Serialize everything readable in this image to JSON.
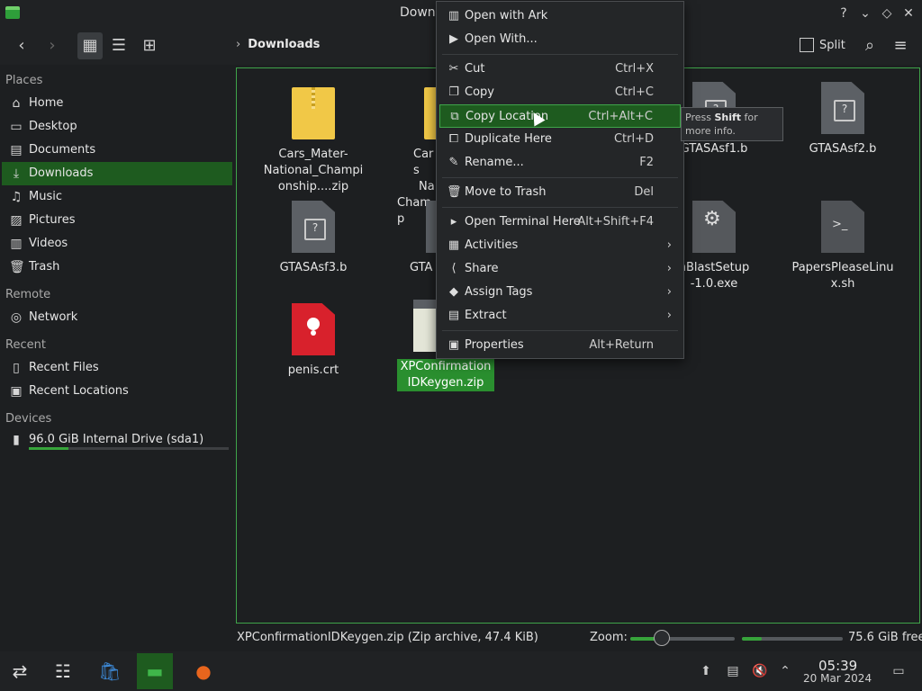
{
  "window": {
    "title": "Downl"
  },
  "toolbar": {
    "location": "Downloads",
    "split_label": "Split"
  },
  "sidebar": {
    "places_label": "Places",
    "places": [
      "Home",
      "Desktop",
      "Documents",
      "Downloads",
      "Music",
      "Pictures",
      "Videos",
      "Trash"
    ],
    "remote_label": "Remote",
    "remote": [
      "Network"
    ],
    "recent_label": "Recent",
    "recent": [
      "Recent Files",
      "Recent Locations"
    ],
    "devices_label": "Devices",
    "devices": [
      "96.0 GiB Internal Drive (sda1)"
    ],
    "drive_usage": 0.2
  },
  "files": [
    {
      "name": "Cars_Mater-National_Championship....zip"
    },
    {
      "name": "Cars"
    },
    {
      "name": "GTASAsf1.b"
    },
    {
      "name": "GTASAsf2.b"
    },
    {
      "name": "GTASAsf3.b"
    },
    {
      "name": "GTA"
    },
    {
      "name": "hBlastSetup-1.0.exe"
    },
    {
      "name": "PapersPleaseLinux.sh"
    },
    {
      "name": "penis.crt"
    },
    {
      "name": "XPConfirmationIDKeygen.zip"
    }
  ],
  "file_fragments": {
    "cars_line2": "Na",
    "cars_line3": "Champ"
  },
  "context_menu": {
    "items": [
      {
        "label": "Open with Ark",
        "shortcut": ""
      },
      {
        "label": "Open With...",
        "shortcut": ""
      },
      {
        "label": "Cut",
        "shortcut": "Ctrl+X"
      },
      {
        "label": "Copy",
        "shortcut": "Ctrl+C"
      },
      {
        "label": "Copy Location",
        "shortcut": "Ctrl+Alt+C"
      },
      {
        "label": "Duplicate Here",
        "shortcut": "Ctrl+D"
      },
      {
        "label": "Rename...",
        "shortcut": "F2"
      },
      {
        "label": "Move to Trash",
        "shortcut": "Del"
      },
      {
        "label": "Open Terminal Here",
        "shortcut": "Alt+Shift+F4"
      },
      {
        "label": "Activities",
        "shortcut": ""
      },
      {
        "label": "Share",
        "shortcut": ""
      },
      {
        "label": "Assign Tags",
        "shortcut": ""
      },
      {
        "label": "Extract",
        "shortcut": ""
      },
      {
        "label": "Properties",
        "shortcut": "Alt+Return"
      }
    ]
  },
  "tooltip": {
    "pre": "Press ",
    "key": "Shift",
    "post": " for more info."
  },
  "status": {
    "info": "XPConfirmationIDKeygen.zip (Zip archive, 47.4 KiB)",
    "zoom_label": "Zoom:",
    "zoom_level": 0.3,
    "free_space": "75.6 GiB free",
    "disk_usage": 0.2
  },
  "clock": {
    "time": "05:39",
    "date": "20 Mar 2024"
  },
  "colors": {
    "accent": "#37a43b",
    "highlight": "#1e5b1f"
  }
}
